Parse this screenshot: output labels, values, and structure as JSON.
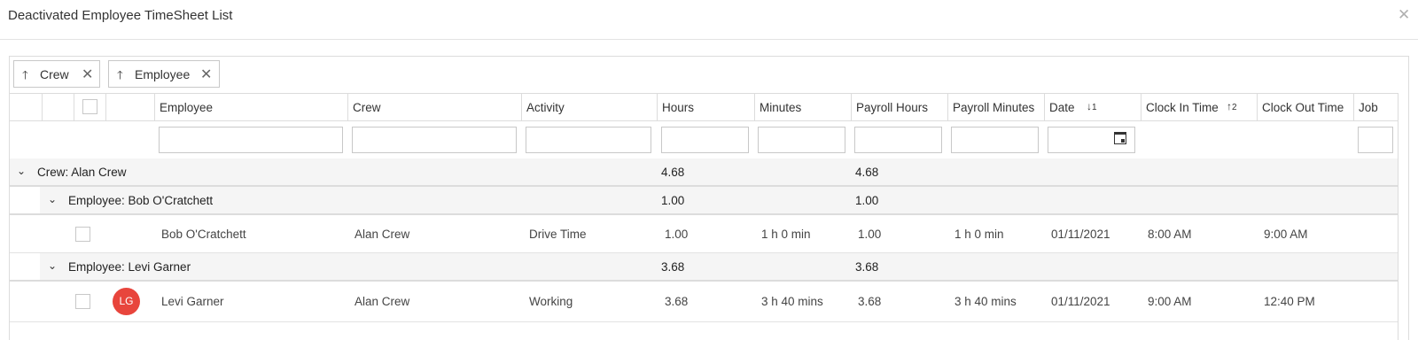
{
  "window": {
    "title": "Deactivated Employee TimeSheet List",
    "close_glyph": "✕"
  },
  "group_panel": {
    "chips": [
      {
        "label": "Crew",
        "arrow": "🡑",
        "remove": "✕"
      },
      {
        "label": "Employee",
        "arrow": "🡑",
        "remove": "✕"
      }
    ]
  },
  "columns": {
    "employee": "Employee",
    "crew": "Crew",
    "activity": "Activity",
    "hours": "Hours",
    "minutes": "Minutes",
    "payroll_hours": "Payroll Hours",
    "payroll_minutes": "Payroll Minutes",
    "date": "Date",
    "date_sort": {
      "arrow": "↓",
      "order": "1"
    },
    "clock_in": "Clock In Time",
    "clock_in_sort": {
      "arrow": "↑",
      "order": "2"
    },
    "clock_out": "Clock Out Time",
    "job": "Job"
  },
  "groups": {
    "crew": {
      "caption": "Crew:  Alan Crew",
      "hours": "4.68",
      "payroll_hours": "4.68"
    },
    "employee1": {
      "caption": "Employee:  Bob O'Cratchett",
      "hours": "1.00",
      "payroll_hours": "1.00"
    },
    "employee2": {
      "caption": "Employee:  Levi Garner",
      "hours": "3.68",
      "payroll_hours": "3.68"
    }
  },
  "rows": [
    {
      "employee": "Bob O'Cratchett",
      "crew": "Alan Crew",
      "activity": "Drive Time",
      "hours": "1.00",
      "minutes": "1 h 0 min",
      "payroll_hours": "1.00",
      "payroll_minutes": "1 h 0 min",
      "date": "01/11/2021",
      "clock_in": "8:00 AM",
      "clock_out": "9:00 AM"
    },
    {
      "employee": "Levi Garner",
      "initials": "LG",
      "avatar_color": "#e8453c",
      "crew": "Alan Crew",
      "activity": "Working",
      "hours": "3.68",
      "minutes": "3 h 40 mins",
      "payroll_hours": "3.68",
      "payroll_minutes": "3 h 40 mins",
      "date": "01/11/2021",
      "clock_in": "9:00 AM",
      "clock_out": "12:40 PM"
    }
  ],
  "colors": {
    "group_bg": "#f5f5f5",
    "border": "#dcdcdc"
  }
}
